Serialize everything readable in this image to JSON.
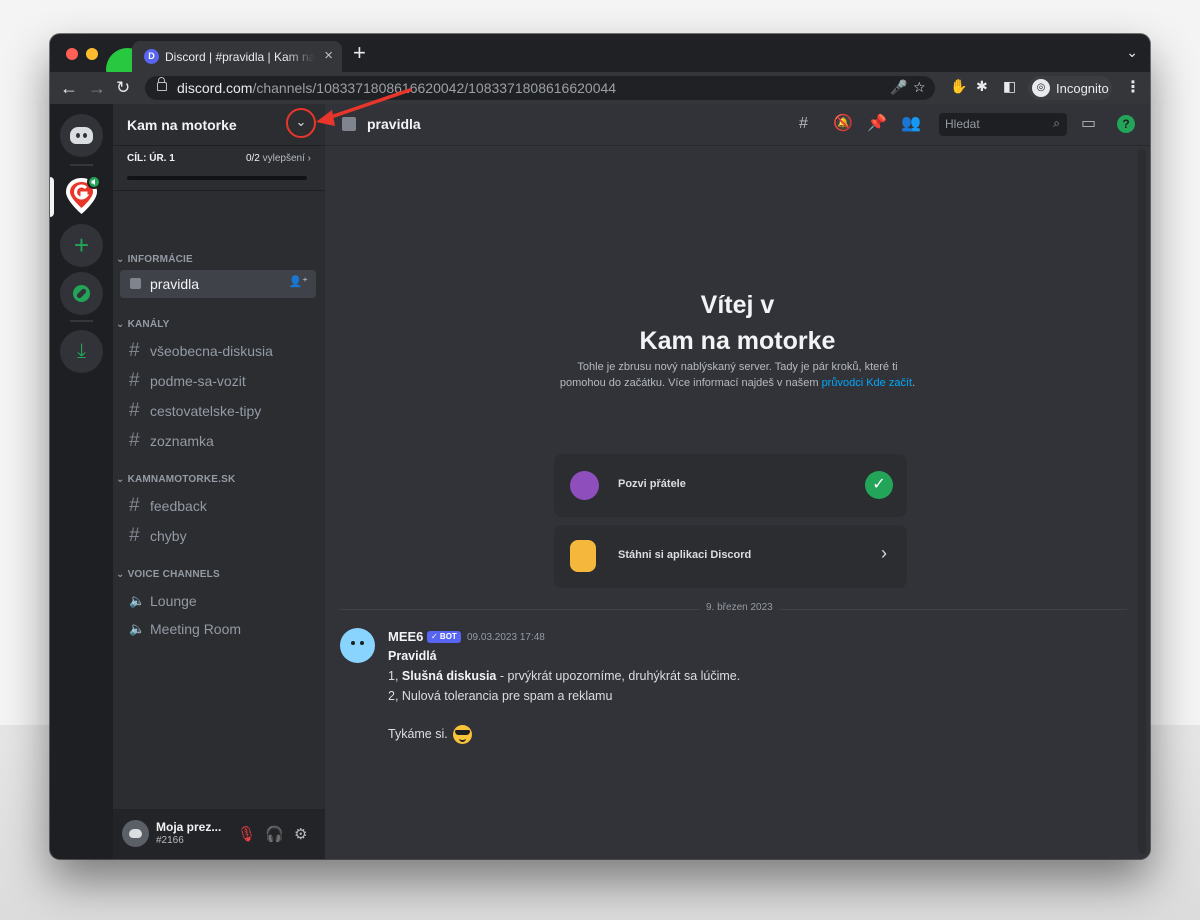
{
  "browser": {
    "tab_title": "Discord | #pravidla | Kam na motorke",
    "tab_close": "×",
    "new_tab": "+",
    "tab_menu": "⌄",
    "url_host": "discord.com",
    "url_path": "/channels/1083371808616620042/1083371808616620044",
    "incognito_label": "Incognito"
  },
  "server": {
    "name": "Kam na motorke",
    "boost_level": "CÍL: ÚR. 1",
    "boost_count": "0/2",
    "boost_unit": "vylepšení",
    "boost_progress": 0.0
  },
  "channels": {
    "cat_info": "INFORMÁCIE",
    "active": "pravidla",
    "cat_channels": "KANÁLY",
    "text": [
      "všeobecna-diskusia",
      "podme-sa-vozit",
      "cestovatelske-tipy",
      "zoznamka"
    ],
    "cat_site": "KAMNAMOTORKE.SK",
    "site": [
      "feedback",
      "chyby"
    ],
    "cat_voice": "VOICE CHANNELS",
    "voice": [
      "Lounge",
      "Meeting Room"
    ]
  },
  "user": {
    "name": "Moja prez...",
    "tag": "#2166"
  },
  "topbar": {
    "channel": "pravidla",
    "search_placeholder": "Hledat",
    "help": "?"
  },
  "welcome": {
    "line1": "Vítej v",
    "line2": "Kam na motorke",
    "desc": "Tohle je zbrusu nový nablýskaný server. Tady je pár kroků, které ti pomohou do začátku. Více informací najdeš v našem",
    "link": "průvodci Kde začít",
    "dot": ".",
    "card1": "Pozvi přátele",
    "card2": "Stáhni si aplikaci Discord"
  },
  "message": {
    "date_divider": "9. březen 2023",
    "author": "MEE6",
    "bot_badge": "✓ BOT",
    "timestamp": "09.03.2023 17:48",
    "title": "Pravidlá",
    "l1_prefix": "1, ",
    "l1_bold": "Slušná diskusia",
    "l1_rest": " - prvýkrát upozorníme, druhýkrát sa lúčime.",
    "l2": "2, Nulová tolerancia pre spam a reklamu",
    "l3": "Tykáme si."
  },
  "colors": {
    "accent": "#5865f2",
    "green": "#23a559",
    "callout": "#e8362a"
  }
}
